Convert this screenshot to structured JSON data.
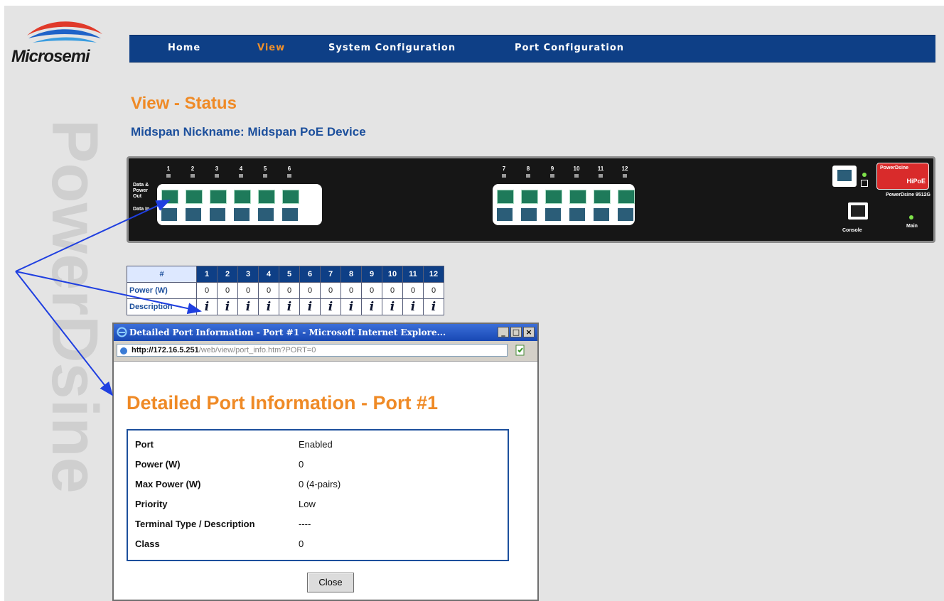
{
  "logo": {
    "text": "Microsemi"
  },
  "watermark": {
    "text": "PowerDsine"
  },
  "nav": {
    "items": [
      {
        "label": "Home",
        "active": false
      },
      {
        "label": "View",
        "active": true
      },
      {
        "label": "System Configuration",
        "active": false
      },
      {
        "label": "Port Configuration",
        "active": false
      }
    ]
  },
  "page": {
    "title": "View - Status",
    "subtitle": "Midspan Nickname: Midspan PoE Device"
  },
  "device": {
    "label_out": "Data & Power Out",
    "label_in": "Data In",
    "ports_left": [
      "1",
      "2",
      "3",
      "4",
      "5",
      "6"
    ],
    "ports_right": [
      "7",
      "8",
      "9",
      "10",
      "11",
      "12"
    ],
    "model": "PowerDsine 9512G",
    "console_label": "Console",
    "main_label": "Main",
    "brand_top": "PowerDsine",
    "brand_bottom": "HiPoE"
  },
  "status_table": {
    "hash_header": "#",
    "ports": [
      "1",
      "2",
      "3",
      "4",
      "5",
      "6",
      "7",
      "8",
      "9",
      "10",
      "11",
      "12"
    ],
    "power_label": "Power (W)",
    "power_values": [
      "0",
      "0",
      "0",
      "0",
      "0",
      "0",
      "0",
      "0",
      "0",
      "0",
      "0",
      "0"
    ],
    "description_label": "Description",
    "info_glyph": "i"
  },
  "popup": {
    "window_title": "Detailed Port Information - Port #1 - Microsoft Internet Explore...",
    "address_host": "http://172.16.5.251",
    "address_path": "/web/view/port_info.htm?PORT=0",
    "heading": "Detailed Port Information - Port #1",
    "rows": [
      {
        "label": "Port",
        "value": "Enabled"
      },
      {
        "label": "Power (W)",
        "value": "0"
      },
      {
        "label": "Max Power (W)",
        "value": "0 (4-pairs)"
      },
      {
        "label": "Priority",
        "value": "Low"
      },
      {
        "label": "Terminal Type / Description",
        "value": "----"
      },
      {
        "label": "Class",
        "value": "0"
      }
    ],
    "close_label": "Close"
  },
  "colors": {
    "nav_bg": "#0e3f86",
    "accent_orange": "#ef8a26",
    "heading_blue": "#1c4f9c",
    "annotation_arrow": "#1f3fe0"
  }
}
